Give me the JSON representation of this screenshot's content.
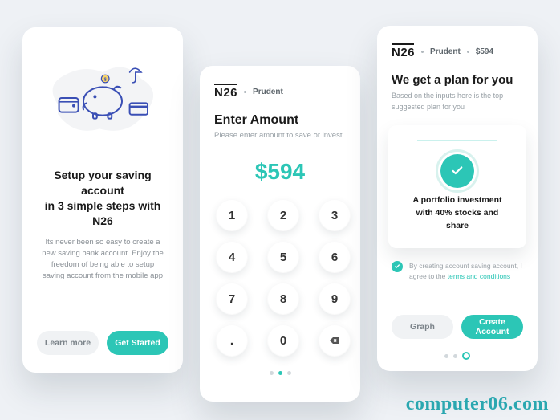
{
  "brand": "N26",
  "screen1": {
    "title_line1": "Setup your saving account",
    "title_line2_prefix": "in 3 simple steps with ",
    "brand": "N26",
    "description": "Its never been so easy to create a new saving bank account. Enjoy the freedom of being able to setup saving account from the mobile app",
    "learn_more": "Learn more",
    "get_started": "Get Started",
    "icons": {
      "piggy": "piggy-bank-icon",
      "umbrella": "umbrella-icon",
      "wallet": "wallet-icon",
      "card": "card-icon",
      "coin": "coin-icon"
    }
  },
  "screen2": {
    "crumb": "Prudent",
    "title": "Enter Amount",
    "subtitle": "Please enter amount to save or invest",
    "amount": "$594",
    "keys": [
      "1",
      "2",
      "3",
      "4",
      "5",
      "6",
      "7",
      "8",
      "9",
      ".",
      "0"
    ],
    "delete_icon": "backspace-icon"
  },
  "screen3": {
    "crumb1": "Prudent",
    "crumb2": "$594",
    "title": "We get a plan for you",
    "subtitle": "Based on the inputs here is the top suggested plan for you",
    "card_text": "A portfolio investment with 40% stocks and share",
    "consent_prefix": "By creating account saving account, I agree to the ",
    "consent_link": "terms and conditions",
    "graph_label": "Graph",
    "create_label": "Create Account"
  },
  "watermark": "computer06.com"
}
